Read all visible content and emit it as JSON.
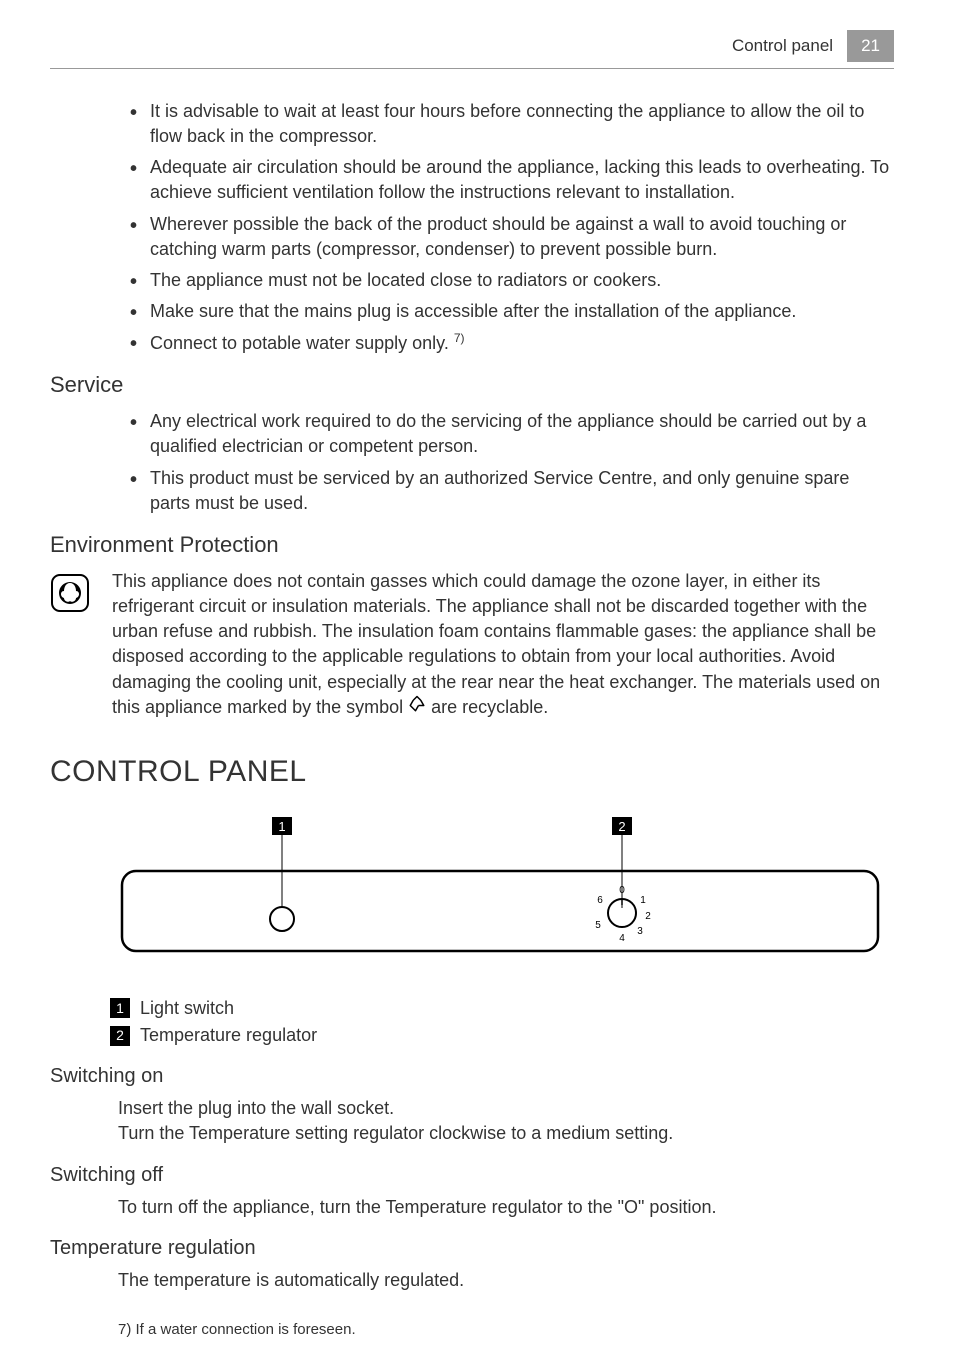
{
  "header": {
    "section": "Control panel",
    "page": "21"
  },
  "installBullets": {
    "b1": "It is advisable to wait at least four hours before connecting the appliance to allow the oil to flow back in the compressor.",
    "b2": "Adequate air circulation should be around the appliance, lacking this leads to overheating. To achieve sufficient ventilation follow the instructions relevant to installation.",
    "b3": "Wherever possible the back of the product should be against a wall to avoid touching or catching warm parts (compressor, condenser) to prevent possible burn.",
    "b4": "The appliance must not be located close to radiators or cookers.",
    "b5": "Make sure that the mains plug is accessible after the installation of the appliance.",
    "b6": "Connect to potable water supply only. ",
    "b6_ref": "7)"
  },
  "service": {
    "heading": "Service",
    "b1": "Any electrical work required to do the servicing of the appliance should be carried out by a qualified electrician or competent person.",
    "b2": "This product must be serviced by an authorized Service Centre, and only genuine spare parts must be used."
  },
  "env": {
    "heading": "Environment Protection",
    "text_before": "This appliance does not contain gasses which could damage the ozone layer, in either its refrigerant circuit or insulation materials. The appliance shall not be discarded together with the urban refuse and rubbish. The insulation foam contains flammable gases: the appliance shall be disposed according to the applicable regulations to obtain from your local authorities. Avoid damaging the cooling unit, especially at the rear near the heat exchanger. The materials used on this appliance marked by the symbol ",
    "text_after": " are recyclable."
  },
  "controlPanel": {
    "heading": "CONTROL PANEL",
    "callout1": "1",
    "callout2": "2",
    "dial": [
      "0",
      "1",
      "2",
      "3",
      "4",
      "5",
      "6"
    ],
    "legend1_num": "1",
    "legend1_text": "Light switch",
    "legend2_num": "2",
    "legend2_text": "Temperature regulator"
  },
  "switchingOn": {
    "heading": "Switching on",
    "line1": "Insert the plug into the wall socket.",
    "line2": "Turn the Temperature setting regulator clockwise to a medium setting."
  },
  "switchingOff": {
    "heading": "Switching off",
    "line1": "To turn off the appliance, turn the Temperature regulator to the \"O\" position."
  },
  "tempReg": {
    "heading": "Temperature regulation",
    "line1": "The temperature is automatically regulated."
  },
  "footnote": "7) If a water connection is foreseen."
}
